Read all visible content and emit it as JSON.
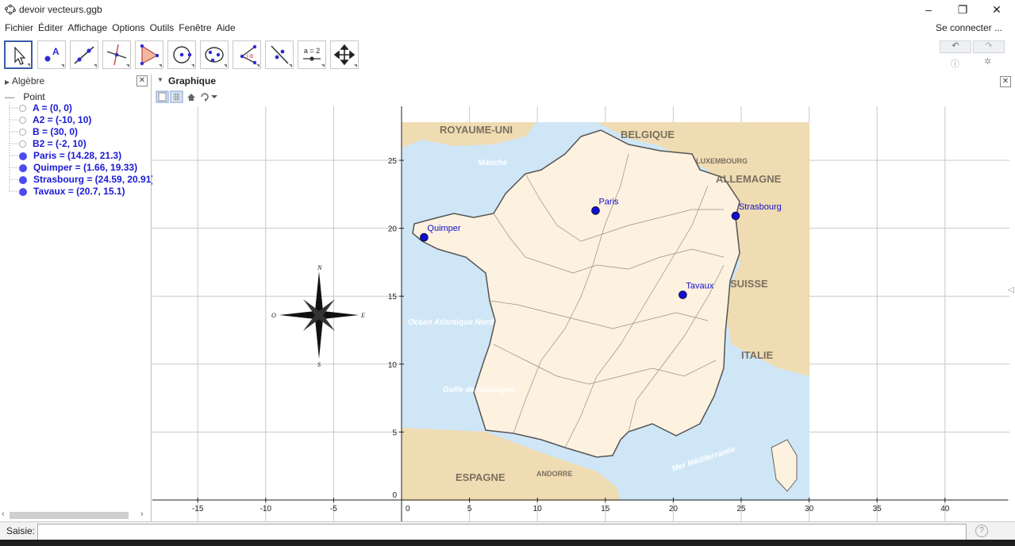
{
  "window": {
    "title": "devoir vecteurs.ggb",
    "minimize": "–",
    "maximize": "❐",
    "close": "✕"
  },
  "menu": {
    "items": [
      "Fichier",
      "Éditer",
      "Affichage",
      "Options",
      "Outils",
      "Fenêtre",
      "Aide"
    ],
    "signin": "Se connecter ..."
  },
  "toolbar": {
    "tools": [
      "move",
      "point",
      "line",
      "perpendicular",
      "polygon",
      "circle",
      "conic",
      "angle",
      "reflect",
      "slider",
      "move-graphics"
    ],
    "slider_label": "a = 2",
    "point_label": "A"
  },
  "algebra": {
    "header": "Algèbre",
    "root": "Point",
    "items": [
      {
        "text": "A = (0, 0)",
        "visible": false
      },
      {
        "text": "A2 = (-10, 10)",
        "visible": false
      },
      {
        "text": "B = (30, 0)",
        "visible": false
      },
      {
        "text": "B2 = (-2, 10)",
        "visible": false
      },
      {
        "text": "Paris = (14.28, 21.3)",
        "visible": true
      },
      {
        "text": "Quimper = (1.66, 19.33)",
        "visible": true
      },
      {
        "text": "Strasbourg = (24.59, 20.91)",
        "visible": true
      },
      {
        "text": "Tavaux = (20.7, 15.1)",
        "visible": true
      }
    ]
  },
  "graphics": {
    "header": "Graphique",
    "x_ticks": [
      -15,
      -10,
      -5,
      0,
      5,
      10,
      15,
      20,
      25,
      30,
      35,
      40
    ],
    "y_ticks": [
      0,
      5,
      10,
      15,
      20,
      25
    ],
    "points": [
      {
        "name": "Paris",
        "x": 14.28,
        "y": 21.3
      },
      {
        "name": "Quimper",
        "x": 1.66,
        "y": 19.33
      },
      {
        "name": "Strasbourg",
        "x": 24.59,
        "y": 20.91
      },
      {
        "name": "Tavaux",
        "x": 20.7,
        "y": 15.1
      }
    ],
    "map_labels": {
      "uk": "ROYAUME-UNI",
      "belgium": "BELGIQUE",
      "luxembourg": "LUXEMBOURG",
      "germany": "ALLEMAGNE",
      "switzerland": "SUISSE",
      "italy": "ITALIE",
      "spain": "ESPAGNE",
      "andorra": "ANDORRE",
      "channel": "Manche",
      "atlantic": "Océan Atlantique Nord",
      "biscay": "Golfe de Gascogne",
      "med": "Mer Méditerranée"
    },
    "compass": {
      "n": "N",
      "s": "S",
      "e": "E",
      "o": "O"
    }
  },
  "input": {
    "label": "Saisie:",
    "value": "",
    "help": "?"
  },
  "colors": {
    "point": "#1010cc",
    "land": "#fdf1e0",
    "foreign": "#f0dcb2",
    "sea": "#cfe6f7"
  }
}
